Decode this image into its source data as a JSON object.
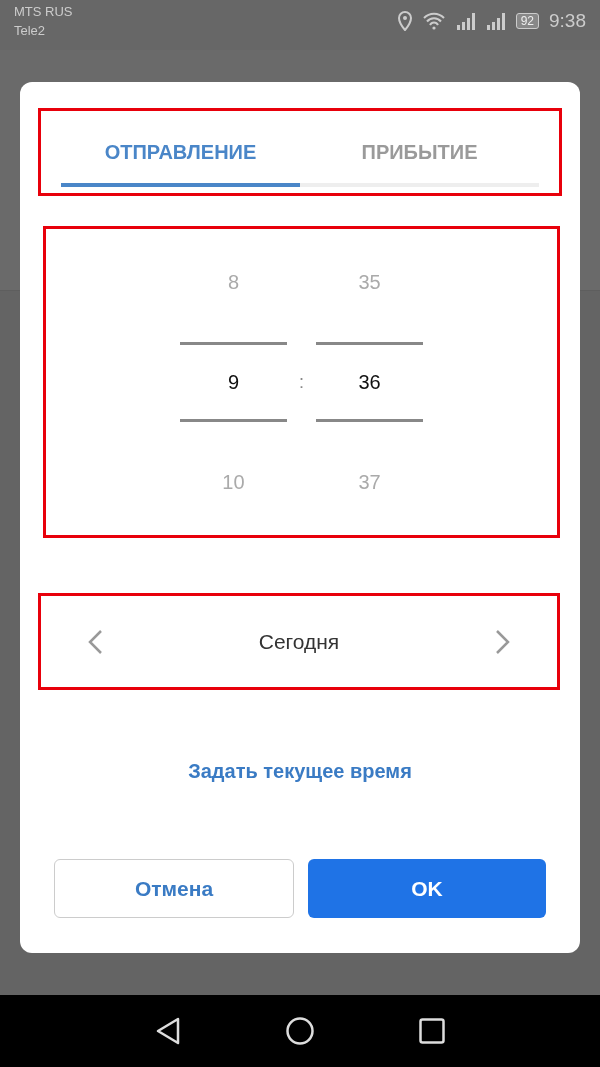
{
  "status_bar": {
    "carriers": [
      "MTS RUS",
      "Tele2"
    ],
    "battery": "92",
    "time": "9:38"
  },
  "dialog": {
    "tabs": [
      {
        "label": "ОТПРАВЛЕНИЕ",
        "selected": true
      },
      {
        "label": "ПРИБЫТИЕ",
        "selected": false
      }
    ],
    "picker": {
      "hours": {
        "above": "8",
        "value": "9",
        "below": "10"
      },
      "separator": ":",
      "minutes": {
        "above": "35",
        "value": "36",
        "below": "37"
      }
    },
    "date": {
      "label": "Сегодня"
    },
    "link": "Задать текущее время",
    "buttons": [
      {
        "label": "Отмена",
        "kind": "secondary"
      },
      {
        "label": "OK",
        "kind": "primary"
      }
    ]
  }
}
